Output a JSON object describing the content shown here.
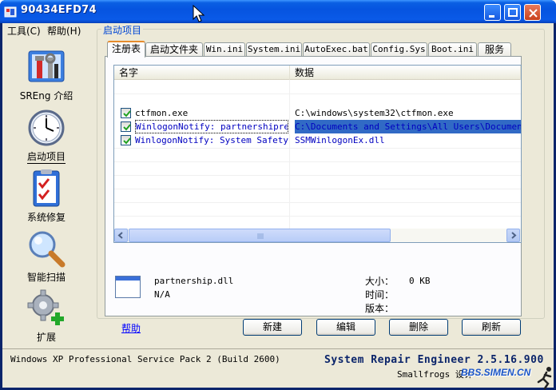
{
  "window": {
    "title": "90434EFD74"
  },
  "menu": [
    {
      "label": "工具(C)"
    },
    {
      "label": "帮助(H)"
    }
  ],
  "nav": [
    {
      "label": "SREng 介绍",
      "icon": "toolbox-icon"
    },
    {
      "label": "启动项目",
      "icon": "clock-icon",
      "active": true
    },
    {
      "label": "系统修复",
      "icon": "checklist-icon"
    },
    {
      "label": "智能扫描",
      "icon": "magnifier-icon"
    },
    {
      "label": "扩展",
      "icon": "gear-plus-icon"
    }
  ],
  "group": {
    "title": "启动项目"
  },
  "tabs": [
    {
      "label": "注册表",
      "active": true
    },
    {
      "label": "启动文件夹"
    },
    {
      "label": "Win.ini"
    },
    {
      "label": "System.ini"
    },
    {
      "label": "AutoExec.bat"
    },
    {
      "label": "Config.Sys"
    },
    {
      "label": "Boot.ini"
    },
    {
      "label": "服务"
    }
  ],
  "list": {
    "columns": [
      "名字",
      "数据"
    ],
    "rows": [
      {
        "name": "ctfmon.exe",
        "data": "C:\\windows\\system32\\ctfmon.exe",
        "checked": true,
        "selected": false,
        "blue": false
      },
      {
        "name": "WinlogonNotify: partnershipreg",
        "data": "C:\\Documents and Settings\\All Users\\Documents\\",
        "checked": true,
        "selected": true,
        "blue": true
      },
      {
        "name": "WinlogonNotify: System Safety...",
        "data": "SSMWinlogonEx.dll",
        "checked": true,
        "selected": false,
        "blue": true
      }
    ]
  },
  "details": {
    "filename": "partnership.dll",
    "company": "N/A",
    "size_label": "大小：",
    "size_value": "0 KB",
    "time_label": "时间：",
    "version_label": "版本："
  },
  "help_link": "帮助",
  "buttons": {
    "new": "新建",
    "edit": "编辑",
    "delete": "删除",
    "refresh": "刷新"
  },
  "status": {
    "os": "Windows XP Professional Service Pack 2 (Build 2600)",
    "app": "System Repair Engineer 2.5.16.900",
    "credit": "Smallfrogs 设计",
    "watermark": "BBS.SIMEN.CN"
  },
  "colors": {
    "titlebar": "#0654e0",
    "selection": "#316ac5",
    "group_title": "#0046d5",
    "link": "#0000ff"
  }
}
